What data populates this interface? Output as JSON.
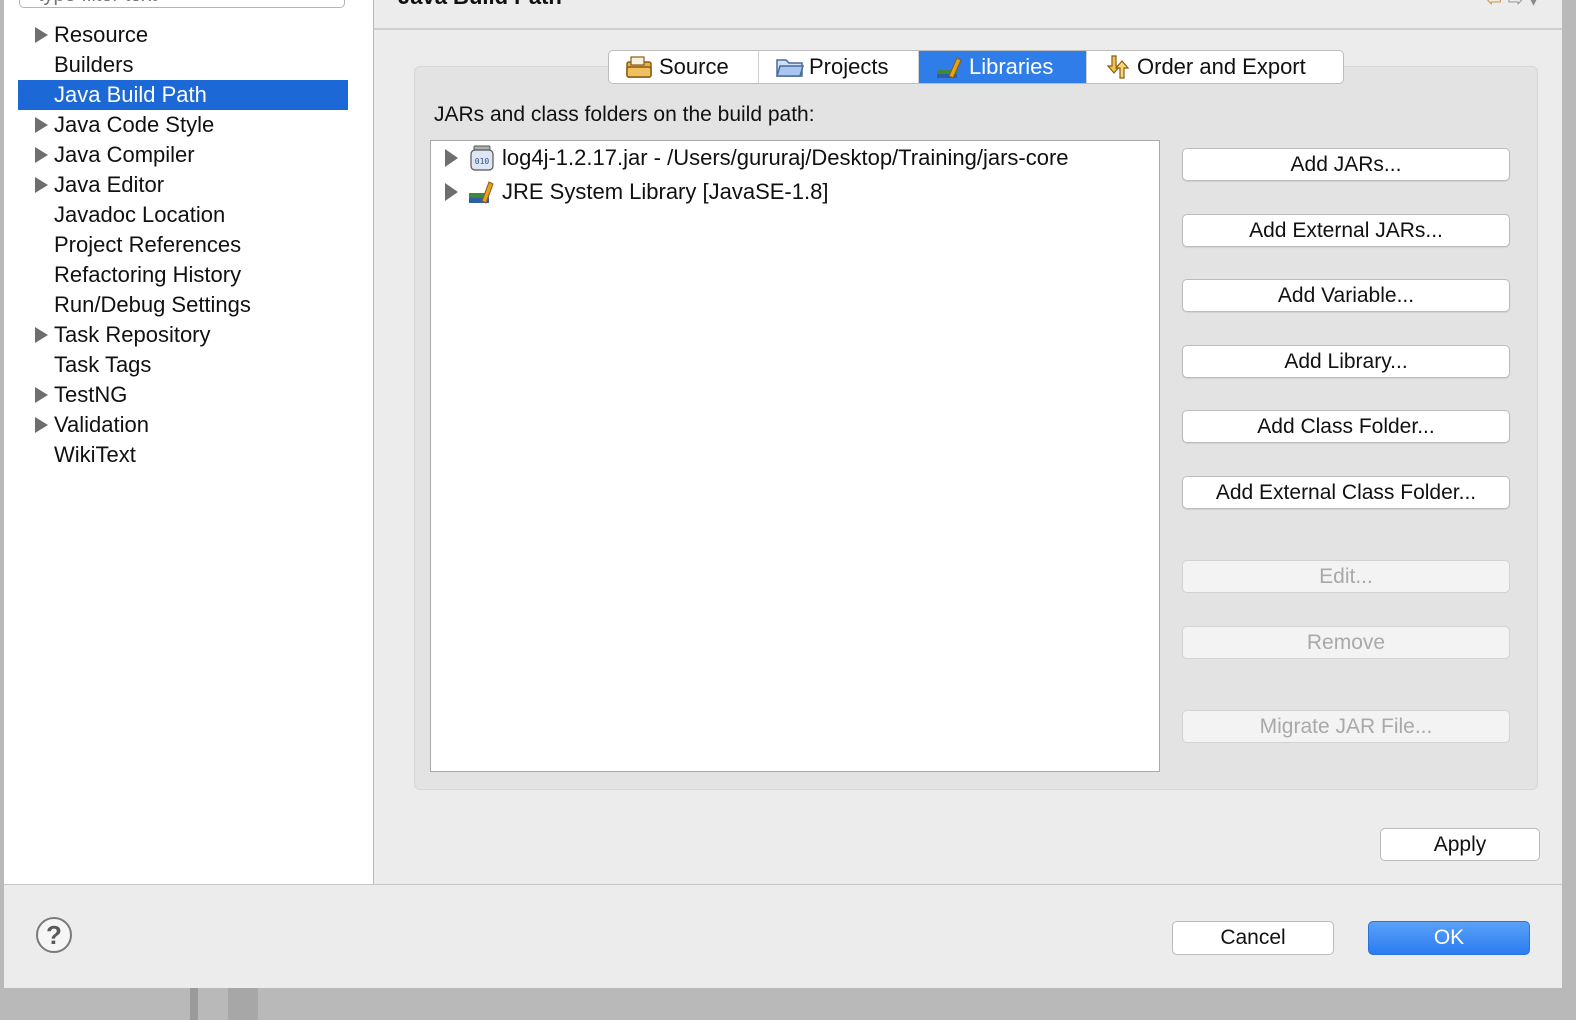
{
  "filter": {
    "placeholder": "type filter text"
  },
  "tree": {
    "items": [
      {
        "label": "Resource",
        "expandable": true
      },
      {
        "label": "Builders",
        "expandable": false
      },
      {
        "label": "Java Build Path",
        "expandable": false,
        "selected": true
      },
      {
        "label": "Java Code Style",
        "expandable": true
      },
      {
        "label": "Java Compiler",
        "expandable": true
      },
      {
        "label": "Java Editor",
        "expandable": true
      },
      {
        "label": "Javadoc Location",
        "expandable": false
      },
      {
        "label": "Project References",
        "expandable": false
      },
      {
        "label": "Refactoring History",
        "expandable": false
      },
      {
        "label": "Run/Debug Settings",
        "expandable": false
      },
      {
        "label": "Task Repository",
        "expandable": true
      },
      {
        "label": "Task Tags",
        "expandable": false
      },
      {
        "label": "TestNG",
        "expandable": true
      },
      {
        "label": "Validation",
        "expandable": true
      },
      {
        "label": "WikiText",
        "expandable": false
      }
    ]
  },
  "page": {
    "title": "Java Build Path"
  },
  "tabs": [
    {
      "label": "Source",
      "icon": "source-folder-icon"
    },
    {
      "label": "Projects",
      "icon": "project-folder-icon"
    },
    {
      "label": "Libraries",
      "icon": "libraries-icon",
      "active": true
    },
    {
      "label": "Order and Export",
      "icon": "order-export-icon"
    }
  ],
  "libraries": {
    "label": "JARs and class folders on the build path:",
    "items": [
      {
        "label": "log4j-1.2.17.jar - /Users/gururaj/Desktop/Training/jars-core",
        "icon": "jar-icon"
      },
      {
        "label": "JRE System Library [JavaSE-1.8]",
        "icon": "library-icon"
      }
    ]
  },
  "buttons": {
    "add_jars": "Add JARs...",
    "add_external_jars": "Add External JARs...",
    "add_variable": "Add Variable...",
    "add_library": "Add Library...",
    "add_class_folder": "Add Class Folder...",
    "add_external_class_folder": "Add External Class Folder...",
    "edit": "Edit...",
    "remove": "Remove",
    "migrate_jar": "Migrate JAR File...",
    "apply": "Apply",
    "cancel": "Cancel",
    "ok": "OK",
    "help": "?"
  },
  "colors": {
    "selection": "#1c68d6",
    "ok_button": "#2a7cf0"
  }
}
